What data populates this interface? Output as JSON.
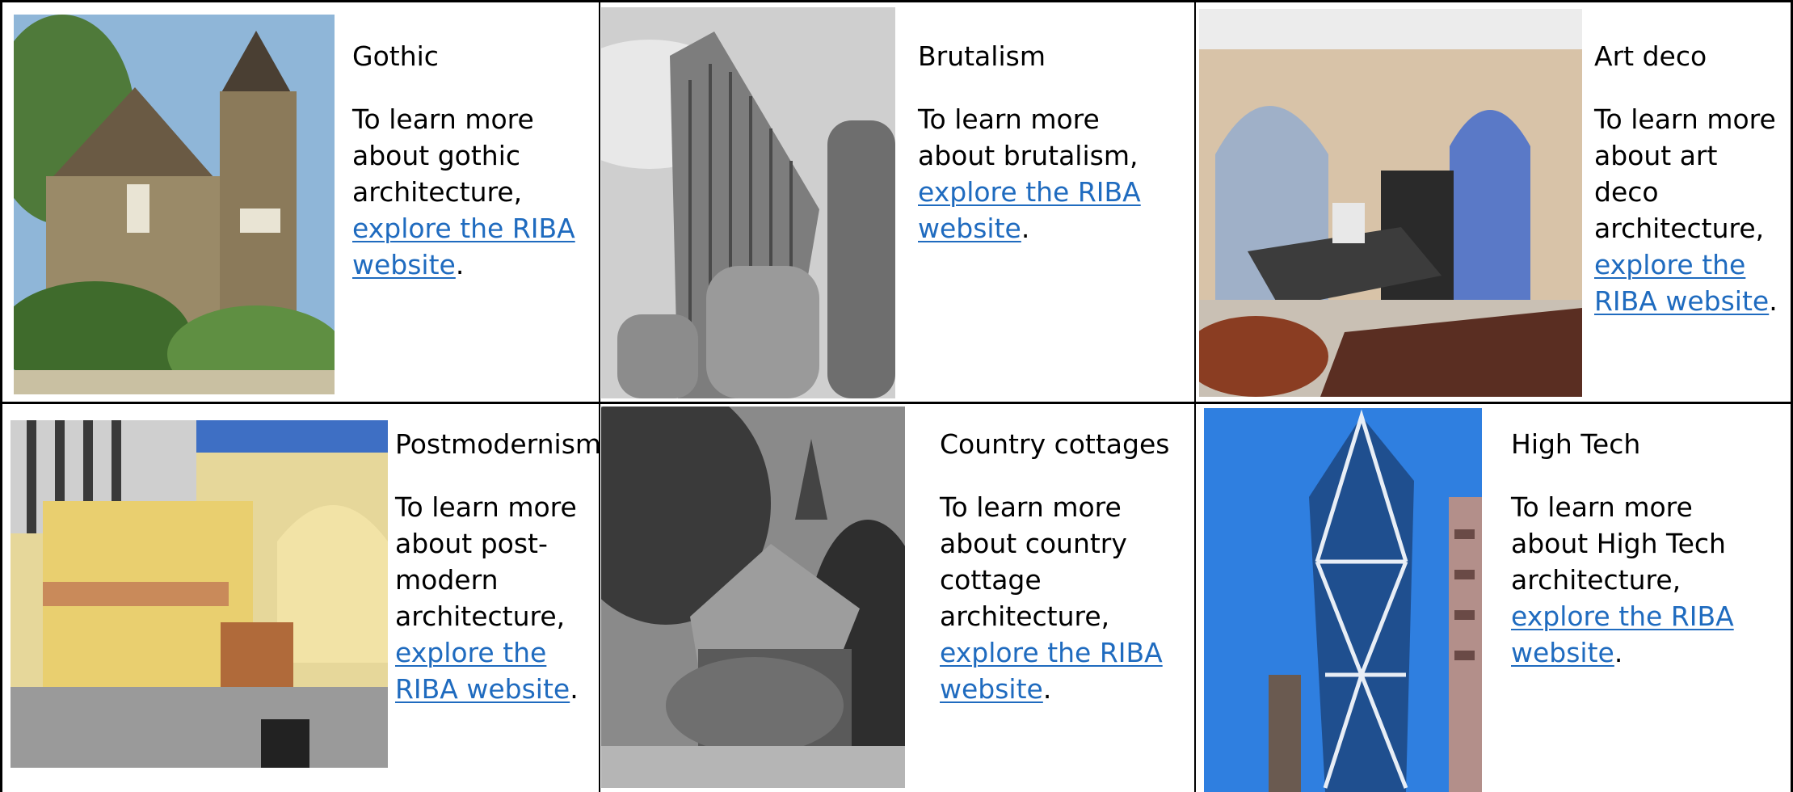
{
  "cells": [
    {
      "title": "Gothic",
      "text_before": "To learn more about gothic architecture, ",
      "link": "explore the RIBA website",
      "text_after": ".",
      "image_icon": "gothic-house-photo"
    },
    {
      "title": "Brutalism",
      "text_before": "To learn more about brutalism, ",
      "link": "explore the RIBA website",
      "text_after": ".",
      "image_icon": "brutalist-tower-photo"
    },
    {
      "title": "Art deco",
      "text_before": "To learn more about art deco architecture, ",
      "link": "explore the RIBA website",
      "text_after": ".",
      "image_icon": "art-deco-interior-illustration"
    },
    {
      "title": "Postmodernism",
      "text_before": "To learn more about post-modern architecture, ",
      "link": "explore the RIBA website",
      "text_after": ".",
      "image_icon": "postmodern-arches-photo"
    },
    {
      "title": "Country cottages",
      "text_before": "To learn more about country cottage architecture, ",
      "link": "explore the RIBA website",
      "text_after": ".",
      "image_icon": "thatched-cottage-photo"
    },
    {
      "title": "High Tech",
      "text_before": "To learn more about High Tech architecture, ",
      "link": "explore the RIBA website",
      "text_after": ".",
      "image_icon": "high-tech-glass-tower-photo"
    }
  ],
  "colors": {
    "link": "#1f6bbf",
    "border": "#000000"
  }
}
